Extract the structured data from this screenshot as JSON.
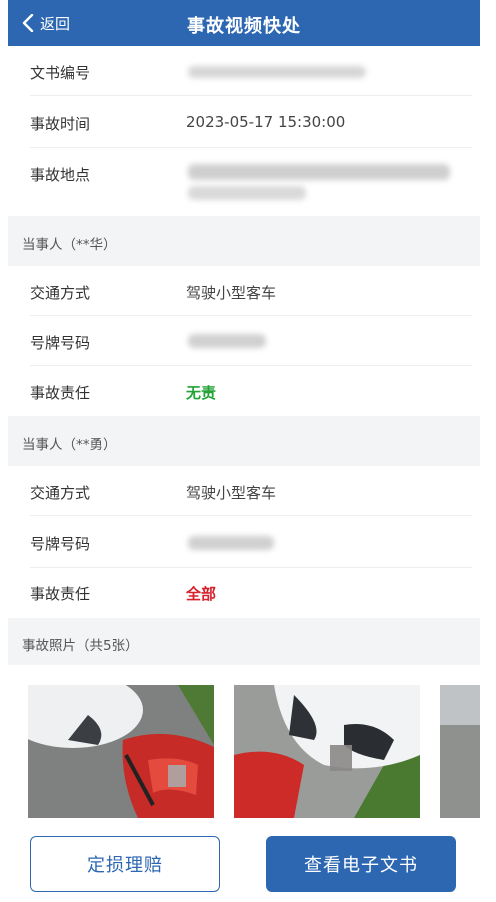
{
  "header": {
    "back_label": "返回",
    "title": "事故视频快处"
  },
  "info": {
    "doc_no_label": "文书编号",
    "time_label": "事故时间",
    "time_value": "2023-05-17 15:30:00",
    "place_label": "事故地点"
  },
  "party1": {
    "header": "当事人（**华）",
    "transport_label": "交通方式",
    "transport_value": "驾驶小型客车",
    "plate_label": "号牌号码",
    "liability_label": "事故责任",
    "liability_value": "无责"
  },
  "party2": {
    "header": "当事人（**勇）",
    "transport_label": "交通方式",
    "transport_value": "驾驶小型客车",
    "plate_label": "号牌号码",
    "liability_label": "事故责任",
    "liability_value": "全部"
  },
  "photos": {
    "header": "事故照片（共5张）"
  },
  "actions": {
    "assess_label": "定损理赔",
    "view_doc_label": "查看电子文书"
  },
  "colors": {
    "brand": "#2d67b2",
    "no_liability": "#23a335",
    "full_liability": "#d6202a"
  }
}
